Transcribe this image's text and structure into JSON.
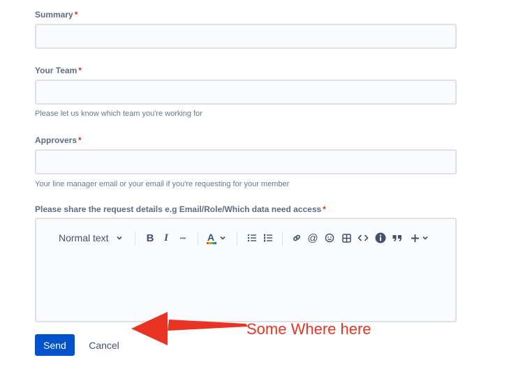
{
  "form": {
    "summary": {
      "label": "Summary",
      "required_mark": "*",
      "value": ""
    },
    "team": {
      "label": "Your Team",
      "required_mark": "*",
      "value": "",
      "help": "Please let us know which team you're working for"
    },
    "approvers": {
      "label": "Approvers",
      "required_mark": "*",
      "value": "",
      "help": "Your line manager email or your email if you're requesting for your member"
    },
    "details": {
      "label": "Please share the request details e.g Email/Role/Which data need access",
      "required_mark": "*"
    }
  },
  "toolbar": {
    "text_style": "Normal text",
    "bold": "B",
    "italic": "I",
    "more": "•••",
    "text_color": "A"
  },
  "actions": {
    "send_label": "Send",
    "cancel_label": "Cancel"
  },
  "annotation": {
    "text": "Some Where here",
    "color": "#ea3323"
  },
  "colors": {
    "primary": "#0052cc",
    "required": "#de350b",
    "label": "#5e6c84",
    "border": "#dfe1e6",
    "field_bg": "#fafbfc"
  }
}
